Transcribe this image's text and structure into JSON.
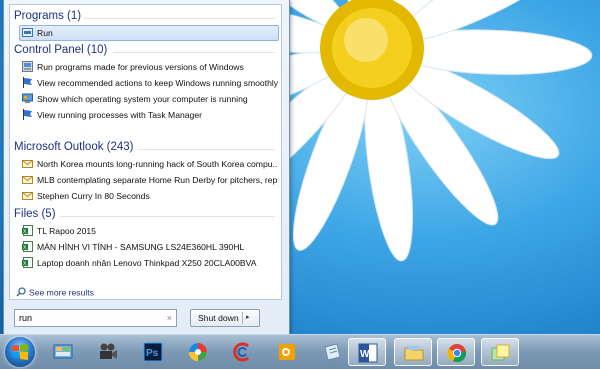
{
  "search": {
    "value": "run",
    "clear_glyph": "×"
  },
  "shutdown": {
    "label": "Shut down",
    "arrow": "▸"
  },
  "see_more": "See more results",
  "groups": {
    "programs": {
      "header": "Programs (1)",
      "items": [
        {
          "label": "Run",
          "icon": "run-icon"
        }
      ]
    },
    "control_panel": {
      "header": "Control Panel (10)",
      "items": [
        {
          "label": "Run programs made for previous versions of Windows",
          "icon": "compatibility-icon"
        },
        {
          "label": "View recommended actions to keep Windows running smoothly",
          "icon": "action-center-flag-icon"
        },
        {
          "label": "Show which operating system your computer is running",
          "icon": "system-icon"
        },
        {
          "label": "View running processes with Task Manager",
          "icon": "task-manager-flag-icon"
        }
      ]
    },
    "outlook": {
      "header": "Microsoft Outlook (243)",
      "items": [
        {
          "label": "North Korea mounts long-running hack of South Korea compu...",
          "icon": "email-icon"
        },
        {
          "label": "MLB contemplating separate Home Run Derby for pitchers, rep...",
          "icon": "email-icon"
        },
        {
          "label": "Stephen Curry In 80 Seconds",
          "icon": "email-icon"
        }
      ]
    },
    "files": {
      "header": "Files (5)",
      "items": [
        {
          "label": "TL Rapoo 2015",
          "icon": "excel-file-icon"
        },
        {
          "label": "MÀN HÌNH VI TÍNH - SAMSUNG LS24E360HL 390HL",
          "icon": "excel-file-icon"
        },
        {
          "label": "Laptop doanh nhân Lenovo Thinkpad X250 20CLA00BVA",
          "icon": "excel-file-icon"
        }
      ]
    }
  },
  "taskbar": {
    "start": "windows-start-orb",
    "apps": [
      "control-panel-icon",
      "video-camera-icon",
      "photoshop-icon",
      "color-wheel-icon",
      "ccleaner-icon",
      "outlook-icon",
      "notepad-icon",
      "word-icon",
      "file-explorer-icon",
      "chrome-icon",
      "sticky-notes-icon"
    ],
    "photoshop_text": "Ps",
    "word_text": "W"
  },
  "colors": {
    "group_header": "#1e3287",
    "selection": "#cfe1f7",
    "taskbar": "#7f9bb6",
    "wallpaper": "#1f8fd6"
  }
}
